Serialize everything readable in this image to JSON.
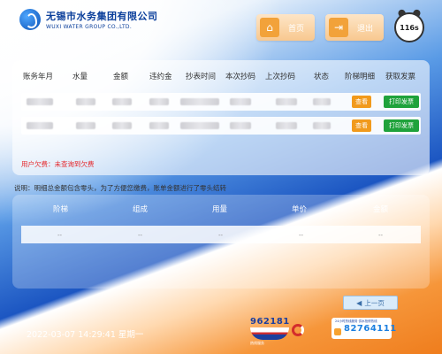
{
  "brand": {
    "name_cn": "无锡市水务集团有限公司",
    "name_en": "WUXI WATER GROUP CO.,LTD."
  },
  "nav": {
    "home_label": "首页",
    "exit_label": "退出",
    "countdown": "116s"
  },
  "bill_table": {
    "headers": [
      "账务年月",
      "水量",
      "金额",
      "违约金",
      "抄表时间",
      "本次抄码",
      "上次抄码",
      "状态",
      "阶梯明细",
      "获取发票"
    ],
    "rows": [
      {
        "view_label": "查看",
        "print_label": "打印发票"
      },
      {
        "view_label": "查看",
        "print_label": "打印发票"
      }
    ],
    "debt_text": "用户欠费：未查询到欠费"
  },
  "note_text": "说明：明细总金额包含零头，为了方便您缴费，账单金额进行了零头结转",
  "tier_table": {
    "headers": [
      "阶梯",
      "组成",
      "用量",
      "单价",
      "金额"
    ],
    "row": [
      "--",
      "--",
      "--",
      "--",
      "--"
    ]
  },
  "prev_page_label": "上一页",
  "datetime": "2022-03-07 14:29:41 星期一",
  "hotline": {
    "number": "962181",
    "sub": "热线服务"
  },
  "help": {
    "text": "24小时热线服务 供水抢修热线",
    "number": "82764111"
  }
}
